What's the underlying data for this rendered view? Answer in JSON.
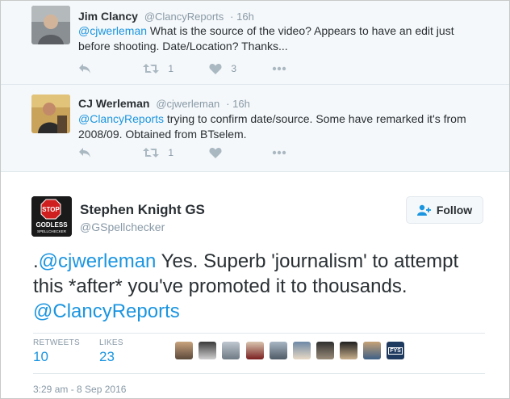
{
  "replies": [
    {
      "name": "Jim Clancy",
      "handle": "@ClancyReports",
      "time": "16h",
      "mention": "@cjwerleman",
      "text": " What is the source of the video?  Appears to have an edit just before shooting.  Date/Location? Thanks...",
      "retweets": "1",
      "likes": "3"
    },
    {
      "name": "CJ Werleman",
      "handle": "@cjwerleman",
      "time": "16h",
      "mention": "@ClancyReports",
      "text": " trying to confirm date/source. Some have remarked it's from 2008/09. Obtained from BTselem.",
      "retweets": "1",
      "likes": ""
    }
  ],
  "main_tweet": {
    "name": "Stephen Knight GS",
    "handle": "@GSpellchecker",
    "follow_label": "Follow",
    "text_prefix": ".",
    "mention1": "@cjwerleman",
    "text_middle": " Yes. Superb 'journalism' to attempt this *after* you've promoted it to thousands.  ",
    "mention2": "@ClancyReports",
    "retweets_label": "RETWEETS",
    "retweets_value": "10",
    "likes_label": "LIKES",
    "likes_value": "23",
    "timestamp": "3:29 am - 8 Sep 2016",
    "avatar_text": {
      "stop": "STOP",
      "line1": "GODLESS",
      "line2": "SPELLCHECKER"
    },
    "liker_badge": "FYS"
  },
  "colors": {
    "link": "#1b95e0",
    "muted": "#8899a6",
    "icon": "#aab8c2",
    "reply_bg": "#f5f8fa"
  }
}
